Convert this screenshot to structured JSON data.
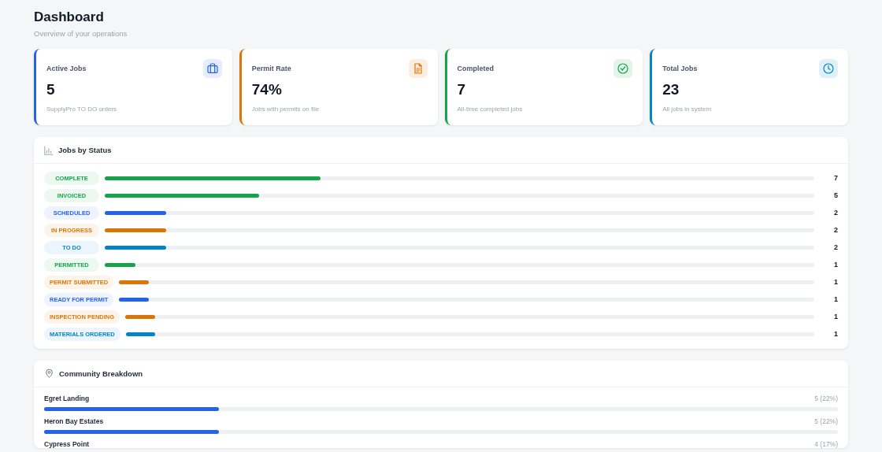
{
  "header": {
    "title": "Dashboard",
    "subtitle": "Overview of your operations"
  },
  "cards": [
    {
      "label": "Active Jobs",
      "value": "5",
      "note": "SupplyPro TO DO orders",
      "color": "#2563eb"
    },
    {
      "label": "Permit Rate",
      "value": "74%",
      "note": "Jobs with permits on file",
      "color": "#d97706"
    },
    {
      "label": "Completed",
      "value": "7",
      "note": "All-time completed jobs",
      "color": "#16a34a"
    },
    {
      "label": "Total Jobs",
      "value": "23",
      "note": "All jobs in system",
      "color": "#0284c7"
    }
  ],
  "jobs_by_status": {
    "title": "Jobs by Status",
    "rows": [
      {
        "status": "COMPLETE",
        "count": "7",
        "level": 0.304,
        "color": "#16a34a"
      },
      {
        "status": "INVOICED",
        "count": "5",
        "level": 0.217,
        "color": "#16a34a"
      },
      {
        "status": "SCHEDULED",
        "count": "2",
        "level": 0.087,
        "color": "#2563eb"
      },
      {
        "status": "IN PROGRESS",
        "count": "2",
        "level": 0.087,
        "color": "#d97706"
      },
      {
        "status": "TO DO",
        "count": "2",
        "level": 0.087,
        "color": "#0284c7"
      },
      {
        "status": "PERMITTED",
        "count": "1",
        "level": 0.043,
        "color": "#16a34a"
      },
      {
        "status": "PERMIT SUBMITTED",
        "count": "1",
        "level": 0.043,
        "color": "#d97706"
      },
      {
        "status": "READY FOR PERMIT",
        "count": "1",
        "level": 0.043,
        "color": "#2563eb"
      },
      {
        "status": "INSPECTION PENDING",
        "count": "1",
        "level": 0.043,
        "color": "#d97706"
      },
      {
        "status": "MATERIALS ORDERED",
        "count": "1",
        "level": 0.043,
        "color": "#0284c7"
      }
    ]
  },
  "community_breakdown": {
    "title": "Community Breakdown",
    "rows": [
      {
        "name": "Egret Landing",
        "count": "5 (22%)",
        "level": 0.22
      },
      {
        "name": "Heron Bay Estates",
        "count": "5 (22%)",
        "level": 0.22
      },
      {
        "name": "Cypress Point",
        "count": "4 (17%)"
      }
    ]
  }
}
